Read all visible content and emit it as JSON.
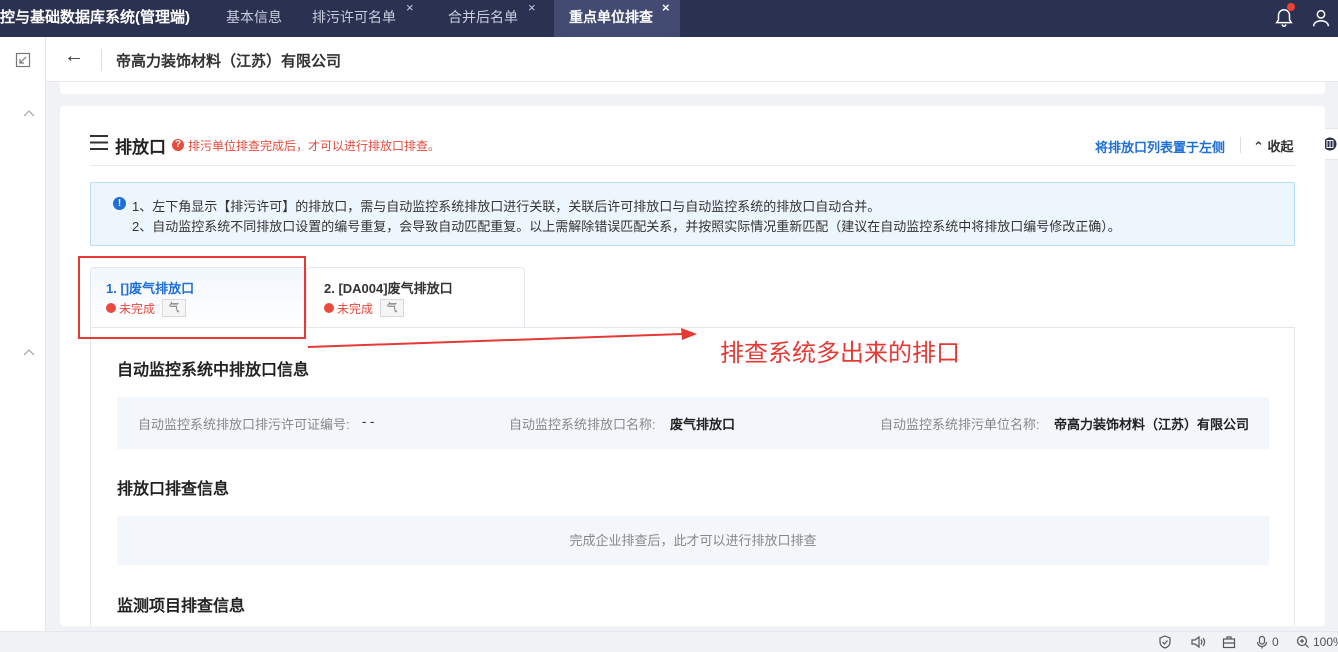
{
  "app": {
    "title": "控与基础数据库系统(管理端)"
  },
  "tabs": [
    {
      "label": "基本信息"
    },
    {
      "label": "排污许可名单"
    },
    {
      "label": "合并后名单"
    },
    {
      "label": "重点单位排查"
    }
  ],
  "tab_close": "×",
  "header": {
    "back": "←",
    "company": "帝高力装饰材料（江苏）有限公司"
  },
  "section": {
    "title": "排放口",
    "warning_icon": "?",
    "warning": "排污单位排查完成后，才可以进行排放口排查。",
    "move_left": "将排放口列表置于左侧",
    "collapse": "⌃ 收起"
  },
  "notice": {
    "icon": "!",
    "line1": "1、左下角显示【排污许可】的排放口，需与自动监控系统排放口进行关联，关联后许可排放口与自动监控系统的排放口自动合并。",
    "line2": "2、自动监控系统不同排放口设置的编号重复，会导致自动匹配重复。以上需解除错误匹配关系，并按照实际情况重新匹配（建议在自动监控系统中将排放口编号修改正确）。"
  },
  "outlets": [
    {
      "name": "1. []废气排放口",
      "status": "未完成",
      "type": "气"
    },
    {
      "name": "2. [DA004]废气排放口",
      "status": "未完成",
      "type": "气"
    }
  ],
  "auto_info": {
    "title": "自动监控系统中排放口信息",
    "permit_label": "自动监控系统排放口排污许可证编号:",
    "permit_value": "- -",
    "name_label": "自动监控系统排放口名称:",
    "name_value": "废气排放口",
    "unit_label": "自动监控系统排污单位名称:",
    "unit_value": "帝高力装饰材料（江苏）有限公司"
  },
  "inspection": {
    "title": "排放口排查信息",
    "empty": "完成企业排查后，此才可以进行排放口排查"
  },
  "monitoring": {
    "title": "监测项目排查信息"
  },
  "annotation": {
    "text": "排查系统多出来的排口"
  },
  "statusbar": {
    "mic_count": "0",
    "zoom": "100%"
  },
  "colors": {
    "topbar": "#2b3150",
    "active_tab": "#434b73",
    "primary": "#1e6fd9",
    "danger": "#e84a3c",
    "annotation": "#e53935"
  }
}
